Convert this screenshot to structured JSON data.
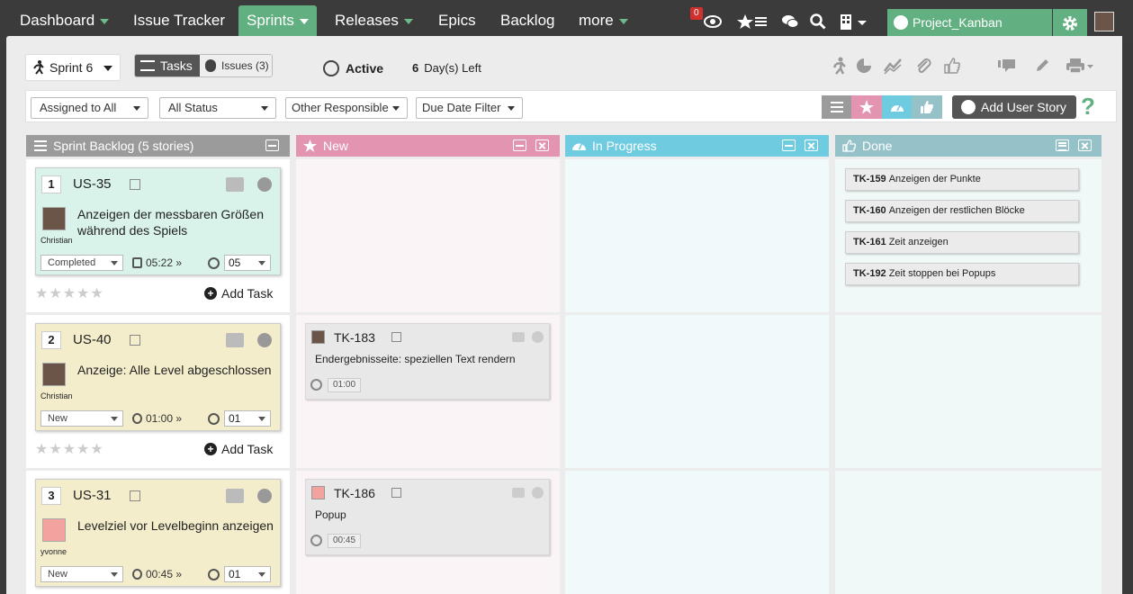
{
  "nav": {
    "items": [
      {
        "label": "Dashboard",
        "caret": true
      },
      {
        "label": "Issue Tracker",
        "caret": false
      },
      {
        "label": "Sprints",
        "caret": true,
        "active": true
      },
      {
        "label": "Releases",
        "caret": true
      },
      {
        "label": "Epics",
        "caret": false
      },
      {
        "label": "Backlog",
        "caret": false
      },
      {
        "label": "more",
        "caret": true
      }
    ],
    "notification_count": "0",
    "project": "Project_Kanban",
    "icons": [
      "eye-icon",
      "star-list-icon",
      "chat-icon",
      "search-icon",
      "building-icon",
      "gear-icon",
      "avatar"
    ]
  },
  "toolbar": {
    "sprint": "Sprint 6",
    "tasks_label": "Tasks",
    "issues_label": "Issues (3)",
    "status": "Active",
    "days_num": "6",
    "days_label": "Day(s) Left",
    "icons": [
      "runner-icon",
      "pie-chart-icon",
      "line-chart-icon",
      "paperclip-icon",
      "thumbs-up-icon",
      "comment-icon",
      "pencil-icon",
      "print-icon"
    ]
  },
  "filters": {
    "assigned": "Assigned to All",
    "status": "All Status",
    "responsible": "Other Responsible",
    "due": "Due Date Filter",
    "add_story": "Add User Story",
    "help": "?"
  },
  "colors": {
    "nav_bg": "#3b3b3b",
    "accent": "#62b081",
    "backlog_head": "#9b9b9b",
    "new_head": "#e394b1",
    "progress_head": "#6fcbe0",
    "done_head": "#95c2c9",
    "story_green": "#d9f3ea",
    "story_yellow": "#f4edcc"
  },
  "columns": [
    {
      "title": "Sprint Backlog (5 stories)"
    },
    {
      "title": "New"
    },
    {
      "title": "In Progress"
    },
    {
      "title": "Done"
    }
  ],
  "stories": [
    {
      "num": "1",
      "id": "US-35",
      "title": "Anzeigen der messbaren Größen während des Spiels",
      "owner": "Christian",
      "status": "Completed",
      "time": "05:22",
      "points": "05",
      "add_task": "Add Task"
    },
    {
      "num": "2",
      "id": "US-40",
      "title": "Anzeige: Alle Level abgeschlossen",
      "owner": "Christian",
      "status": "New",
      "time": "01:00",
      "points": "01",
      "add_task": "Add Task"
    },
    {
      "num": "3",
      "id": "US-31",
      "title": "Levelziel vor Levelbeginn anzeigen",
      "owner": "yvonne",
      "status": "New",
      "time": "00:45",
      "points": "01",
      "add_task": "Add Task"
    }
  ],
  "tasks_new": [
    {
      "id": "TK-183",
      "title": "Endergebnisseite: speziellen Text rendern",
      "time": "01:00"
    },
    {
      "id": "TK-186",
      "title": "Popup",
      "time": "00:45"
    }
  ],
  "done_tasks": [
    {
      "id": "TK-159",
      "title": "Anzeigen der Punkte"
    },
    {
      "id": "TK-160",
      "title": "Anzeigen der restlichen Blöcke"
    },
    {
      "id": "TK-161",
      "title": "Zeit anzeigen"
    },
    {
      "id": "TK-192",
      "title": "Zeit stoppen bei Popups"
    }
  ]
}
